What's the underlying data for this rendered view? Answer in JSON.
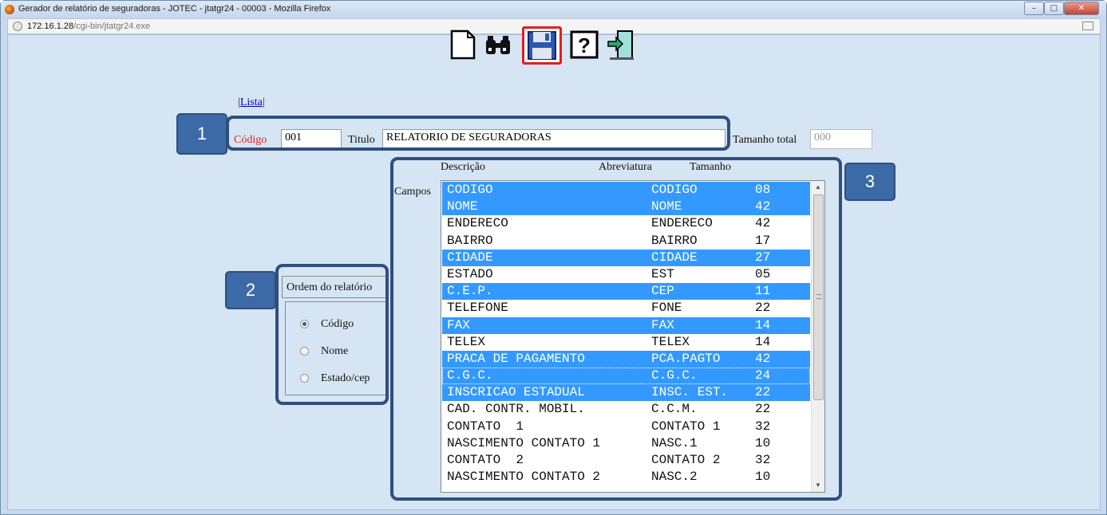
{
  "window": {
    "title": "Gerador de relatório de seguradoras - JOTEC - jtatgr24 - 00003 - Mozilla Firefox",
    "url_host": "172.16.1.28",
    "url_path": "/cgi-bin/jtatgr24.exe"
  },
  "toolbar": {
    "icons": [
      "new-document-icon",
      "binoculars-search-icon",
      "floppy-save-icon",
      "help-icon",
      "exit-door-icon"
    ],
    "highlight_color": "#e0201b"
  },
  "nav": {
    "lista_label": "Lista"
  },
  "header": {
    "codigo_label": "Código",
    "codigo_value": "001",
    "titulo_label": "Titulo",
    "titulo_value": "RELATORIO DE SEGURADORAS",
    "tamanho_label": "Tamanho total",
    "tamanho_value": "000"
  },
  "callouts": {
    "one": "1",
    "two": "2",
    "three": "3",
    "color": "#3c6aa6"
  },
  "ordem": {
    "title": "Ordem do relatório",
    "options": [
      "Código",
      "Nome",
      "Estado/cep"
    ],
    "selected": "Código"
  },
  "campos": {
    "label": "Campos",
    "headers": {
      "descricao": "Descrição",
      "abreviatura": "Abreviatura",
      "tamanho": "Tamanho"
    },
    "selection_color": "#3399ff",
    "rows": [
      {
        "desc": "CODIGO",
        "abrev": "CODIGO",
        "tam": "08",
        "selected": true
      },
      {
        "desc": "NOME",
        "abrev": "NOME",
        "tam": "42",
        "selected": true
      },
      {
        "desc": "ENDERECO",
        "abrev": "ENDERECO",
        "tam": "42",
        "selected": false
      },
      {
        "desc": "BAIRRO",
        "abrev": "BAIRRO",
        "tam": "17",
        "selected": false
      },
      {
        "desc": "CIDADE",
        "abrev": "CIDADE",
        "tam": "27",
        "selected": true
      },
      {
        "desc": "ESTADO",
        "abrev": "EST",
        "tam": "05",
        "selected": false
      },
      {
        "desc": "C.E.P.",
        "abrev": "CEP",
        "tam": "11",
        "selected": true
      },
      {
        "desc": "TELEFONE",
        "abrev": "FONE",
        "tam": "22",
        "selected": false
      },
      {
        "desc": "FAX",
        "abrev": "FAX",
        "tam": "14",
        "selected": true
      },
      {
        "desc": "TELEX",
        "abrev": "TELEX",
        "tam": "14",
        "selected": false
      },
      {
        "desc": "PRACA DE PAGAMENTO",
        "abrev": "PCA.PAGTO",
        "tam": "42",
        "selected": true
      },
      {
        "desc": "C.G.C.",
        "abrev": "C.G.C.",
        "tam": "24",
        "selected": true
      },
      {
        "desc": "INSCRICAO ESTADUAL",
        "abrev": "INSC. EST.",
        "tam": "22",
        "selected": true
      },
      {
        "desc": "CAD. CONTR. MOBIL.",
        "abrev": "C.C.M.",
        "tam": "22",
        "selected": false
      },
      {
        "desc": "CONTATO  1",
        "abrev": "CONTATO 1",
        "tam": "32",
        "selected": false
      },
      {
        "desc": "NASCIMENTO CONTATO 1",
        "abrev": "NASC.1",
        "tam": "10",
        "selected": false
      },
      {
        "desc": "CONTATO  2",
        "abrev": "CONTATO 2",
        "tam": "32",
        "selected": false
      },
      {
        "desc": "NASCIMENTO CONTATO 2",
        "abrev": "NASC.2",
        "tam": "10",
        "selected": false
      }
    ]
  }
}
